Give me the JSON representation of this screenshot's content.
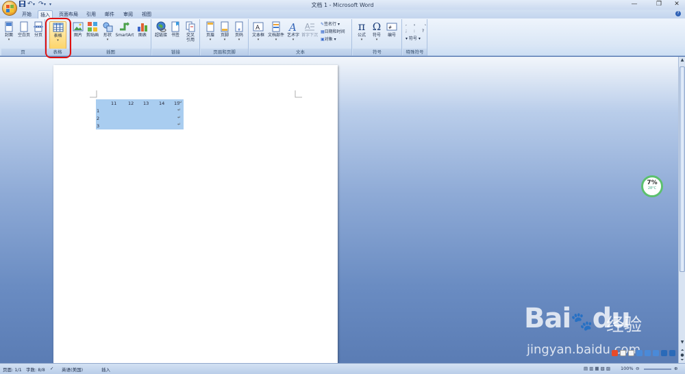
{
  "app": {
    "title": "文档 1 - Microsoft Word"
  },
  "quick_access": {
    "undo_label": "↶",
    "redo_label": "↷"
  },
  "window_controls": {
    "minimize": "—",
    "restore": "❐",
    "close": "✕"
  },
  "tabs": [
    {
      "label": "开始"
    },
    {
      "label": "插入"
    },
    {
      "label": "页面布局"
    },
    {
      "label": "引用"
    },
    {
      "label": "邮件"
    },
    {
      "label": "审阅"
    },
    {
      "label": "视图"
    }
  ],
  "active_tab": "插入",
  "ribbon": {
    "groups": {
      "pages": "页",
      "tables": "表格",
      "illustrations": "插图",
      "links": "链接",
      "header_footer": "页眉和页脚",
      "text": "文本",
      "symbols": "符号",
      "special_symbols": "特殊符号"
    },
    "buttons": {
      "cover": "封面",
      "blank_page": "空白页",
      "page_break": "分页",
      "table": "表格",
      "picture": "图片",
      "clip_art": "剪贴画",
      "shapes": "形状",
      "smartart": "SmartArt",
      "chart": "图表",
      "hyperlink": "超链接",
      "bookmark": "书签",
      "cross_ref_1": "交叉",
      "cross_ref_2": "引用",
      "header": "页眉",
      "footer": "页脚",
      "page_number": "页码",
      "text_box": "文本框",
      "quick_parts": "文档部件",
      "wordart": "艺术字",
      "drop_cap": "首字下沉",
      "signature_line": "签名行",
      "date_time": "日期和时间",
      "object": "对象",
      "equation": "公式",
      "symbol": "符号",
      "numbering": "编号",
      "special_symbol": "符号"
    }
  },
  "document": {
    "table": {
      "header": [
        "11",
        "12",
        "13",
        "14",
        "15"
      ],
      "rows": [
        "1",
        "2",
        "3"
      ]
    }
  },
  "widget": {
    "percent": "7%",
    "temperature": "28°C"
  },
  "statusbar": {
    "page": "页面: 1/1",
    "words": "字数: 8/8",
    "language": "英语(美国)",
    "mode": "插入",
    "zoom": "100%"
  },
  "watermark": {
    "brand_left": "Bai",
    "brand_right": "du",
    "brand_cn": "经验",
    "url": "jingyan.baidu.com"
  },
  "colors": {
    "highlight": "#e01010",
    "selection": "#a9cdf0",
    "ribbon": "#dbe7f6"
  }
}
